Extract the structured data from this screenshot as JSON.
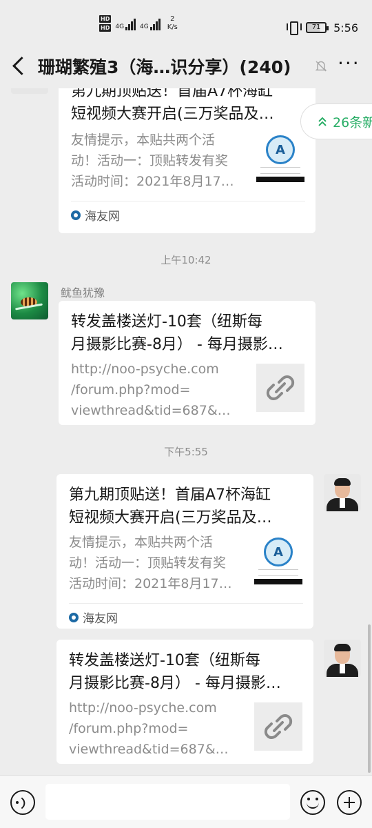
{
  "status_bar": {
    "network_1": "4G",
    "network_2": "4G",
    "speed_value": "2",
    "speed_unit": "K/s",
    "battery": "71",
    "time": "5:56"
  },
  "header": {
    "title": "珊瑚繁殖3（海…识分享）(240)"
  },
  "new_messages": {
    "label": "26条新",
    "icon": "double-chevron-up-icon"
  },
  "messages": [
    {
      "title_line1": "第九期顶贴送！首届A7杯海缸",
      "title_line2": "短视频大赛开启(三万奖品及…",
      "desc_line1": "友情提示，本贴共两个活",
      "desc_line2": "动！活动一：顶贴转发有奖",
      "desc_line3": "活动时间：2021年8月17…",
      "source": "海友网",
      "thumb_mark": "A"
    },
    {
      "timestamp": "上午10:42",
      "sender": "鱿鱼犹豫",
      "title_line1": "转发盖楼送灯-10套（纽斯每",
      "title_line2": "月摄影比赛-8月） - 每月摄影…",
      "desc_line1": "http://noo-psyche.com",
      "desc_line2": "/forum.php?mod=",
      "desc_line3": "viewthread&tid=687&mo…"
    },
    {
      "timestamp": "下午5:55",
      "title_line1": "第九期顶贴送！首届A7杯海缸",
      "title_line2": "短视频大赛开启(三万奖品及…",
      "desc_line1": "友情提示，本贴共两个活",
      "desc_line2": "动！活动一：顶贴转发有奖",
      "desc_line3": "活动时间：2021年8月17…",
      "source": "海友网",
      "thumb_mark": "A"
    },
    {
      "title_line1": "转发盖楼送灯-10套（纽斯每",
      "title_line2": "月摄影比赛-8月） - 每月摄影…",
      "desc_line1": "http://noo-psyche.com",
      "desc_line2": "/forum.php?mod=",
      "desc_line3": "viewthread&tid=687&mo…"
    }
  ],
  "colors": {
    "background": "#ededed",
    "accent_green": "#2aae67",
    "bubble": "#ffffff",
    "muted_text": "#8c8c8c"
  }
}
